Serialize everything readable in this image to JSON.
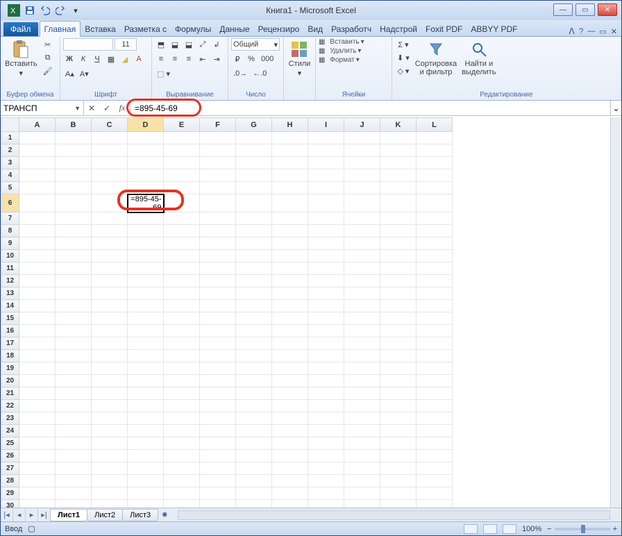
{
  "window": {
    "title": "Книга1 - Microsoft Excel"
  },
  "qat": {
    "save": "save-icon",
    "undo": "undo-icon",
    "redo": "redo-icon"
  },
  "tabs": {
    "file": "Файл",
    "items": [
      "Главная",
      "Вставка",
      "Разметка с",
      "Формулы",
      "Данные",
      "Рецензиро",
      "Вид",
      "Разработч",
      "Надстрой",
      "Foxit PDF",
      "ABBYY PDF"
    ],
    "active": 0
  },
  "ribbon": {
    "clipboard": {
      "label": "Буфер обмена",
      "paste": "Вставить"
    },
    "font": {
      "label": "Шрифт",
      "name": "",
      "size": "11"
    },
    "align": {
      "label": "Выравнивание"
    },
    "number": {
      "label": "Число",
      "format": "Общий"
    },
    "styles": {
      "label": "",
      "btn": "Стили"
    },
    "cells": {
      "label": "Ячейки",
      "insert": "Вставить",
      "delete": "Удалить",
      "format": "Формат"
    },
    "editing": {
      "label": "Редактирование",
      "sort": "Сортировка\nи фильтр",
      "find": "Найти и\nвыделить"
    }
  },
  "formula_bar": {
    "name": "ТРАНСП",
    "formula": "=895-45-69"
  },
  "grid": {
    "columns": [
      "A",
      "B",
      "C",
      "D",
      "E",
      "F",
      "G",
      "H",
      "I",
      "J",
      "K",
      "L"
    ],
    "row_count": 30,
    "active": {
      "row": 6,
      "col": "D",
      "display": "=895-45-69"
    },
    "highlight_col": "D",
    "highlight_row": 6
  },
  "sheets": {
    "items": [
      "Лист1",
      "Лист2",
      "Лист3"
    ],
    "active": 0
  },
  "status": {
    "mode": "Ввод",
    "zoom": "100%",
    "minus": "−",
    "plus": "+"
  }
}
